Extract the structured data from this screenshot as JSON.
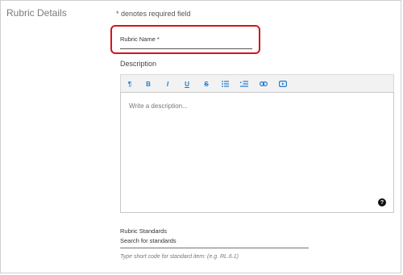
{
  "section": {
    "title": "Rubric Details"
  },
  "form": {
    "required_note": "* denotes required field",
    "rubric_name": {
      "label": "Rubric Name *",
      "value": ""
    },
    "description": {
      "label": "Description",
      "placeholder": "Write a description..."
    },
    "toolbar": {
      "buttons": [
        {
          "name": "paragraph",
          "glyph": "¶"
        },
        {
          "name": "bold",
          "glyph": "B"
        },
        {
          "name": "italic",
          "glyph": "I"
        },
        {
          "name": "underline",
          "glyph": "U"
        },
        {
          "name": "strikethrough",
          "glyph": "S"
        },
        {
          "name": "bulleted-list",
          "glyph": ""
        },
        {
          "name": "indent",
          "glyph": ""
        },
        {
          "name": "link",
          "glyph": ""
        },
        {
          "name": "embed-video",
          "glyph": ""
        }
      ]
    },
    "help": {
      "glyph": "?"
    },
    "standards": {
      "label": "Rubric Standards",
      "input_text": "Search for standards",
      "hint": "Type short code for standard item: (e.g. RL.6.1)"
    }
  },
  "colors": {
    "highlight": "#d4151b",
    "toolbar_icon": "#1a7cd1"
  }
}
